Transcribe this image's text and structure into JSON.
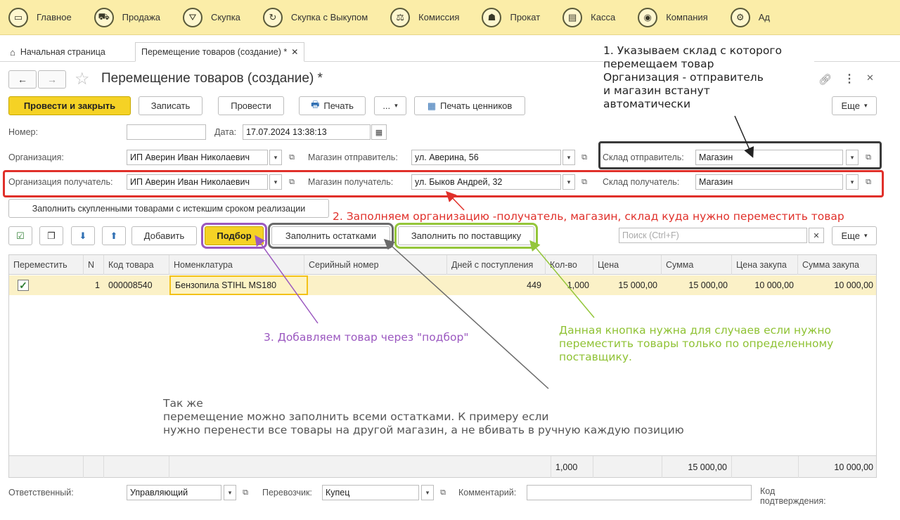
{
  "sections": [
    {
      "label": "Главное",
      "icon": "monitor-icon",
      "glyph": "▭"
    },
    {
      "label": "Продажа",
      "icon": "cart-icon",
      "glyph": "⛟"
    },
    {
      "label": "Скупка",
      "icon": "basket-icon",
      "glyph": "⛛"
    },
    {
      "label": "Скупка с Выкупом",
      "icon": "cycle-icon",
      "glyph": "↻"
    },
    {
      "label": "Комиссия",
      "icon": "scales-icon",
      "glyph": "⚖"
    },
    {
      "label": "Прокат",
      "icon": "rent-icon",
      "glyph": "☗"
    },
    {
      "label": "Касса",
      "icon": "cashbox-icon",
      "glyph": "▤"
    },
    {
      "label": "Компания",
      "icon": "company-icon",
      "glyph": "◉"
    },
    {
      "label": "Ад",
      "icon": "admin-icon",
      "glyph": "⚙"
    }
  ],
  "tabs": {
    "home": "Начальная страница",
    "doc": "Перемещение товаров (создание) *"
  },
  "header": {
    "title": "Перемещение товаров (создание) *"
  },
  "toolbar": {
    "post_close": "Провести и закрыть",
    "write": "Записать",
    "post": "Провести",
    "print": "Печать",
    "more_dots": "...",
    "print_prices": "Печать ценников",
    "more": "Еще"
  },
  "form": {
    "number_label": "Номер:",
    "number_value": "",
    "date_label": "Дата:",
    "date_value": "17.07.2024 13:38:13",
    "org_label": "Организация:",
    "org_value": "ИП Аверин Иван Николаевич",
    "shop_from_label": "Магазин отправитель:",
    "shop_from_value": "ул. Аверина, 56",
    "wh_from_label": "Склад отправитель:",
    "wh_from_value": "Магазин",
    "org_to_label": "Организация получатель:",
    "org_to_value": "ИП Аверин Иван Николаевич",
    "shop_to_label": "Магазин получатель:",
    "shop_to_value": "ул. Быков Андрей, 32",
    "wh_to_label": "Склад получатель:",
    "wh_to_value": "Магазин"
  },
  "fill_expired": "Заполнить скупленными товарами с истекшим сроком реализации",
  "tabletools": {
    "add": "Добавить",
    "pick": "Подбор",
    "fill_rest": "Заполнить остатками",
    "fill_supplier": "Заполнить по поставщику",
    "search_placeholder": "Поиск (Ctrl+F)",
    "more": "Еще"
  },
  "table": {
    "columns": [
      "Переместить",
      "N",
      "Код товара",
      "Номенклатура",
      "Серийный номер",
      "Дней с поступления",
      "Кол-во",
      "Цена",
      "Сумма",
      "Цена закупа",
      "Сумма закупа"
    ],
    "rows": [
      {
        "move": true,
        "n": "1",
        "code": "000008540",
        "name": "Бензопила STIHL MS180",
        "serial": "",
        "days": "449",
        "qty": "1,000",
        "price": "15 000,00",
        "sum": "15 000,00",
        "buy_price": "10 000,00",
        "buy_sum": "10 000,00"
      }
    ],
    "totals": {
      "qty": "1,000",
      "sum": "15 000,00",
      "buy_sum": "10 000,00"
    }
  },
  "bottom": {
    "responsible_label": "Ответственный:",
    "responsible_value": "Управляющий",
    "carrier_label": "Перевозчик:",
    "carrier_value": "Купец",
    "comment_label": "Комментарий:",
    "comment_value": "",
    "code_label_1": "Код",
    "code_label_2": "подтверждения:"
  },
  "notes": {
    "n1_l1": "1. Указываем склад с которого",
    "n1_l2": "перемещаем товар",
    "n1_l3": "Организация - отправитель",
    "n1_l4": "и магазин встанут",
    "n1_l5": "автоматически",
    "n2": "2. Заполняем организацию -получатель, магазин, склад куда нужно переместить товар",
    "n3": "3. Добавляем товар через \"подбор\"",
    "n4_l1": "Данная кнопка нужна для случаев если нужно",
    "n4_l2": "переместить товары только по определенному",
    "n4_l3": "поставщику.",
    "n5_l1": "Так же",
    "n5_l2": "перемещение можно заполнить всеми остатками. К примеру если",
    "n5_l3": "нужно перенести все товары на другой магазин, а не вбивать в ручную каждую позицию"
  },
  "colors": {
    "accent": "#f5d225",
    "red": "#e0302a",
    "purple": "#9b58c0",
    "green": "#94c63a",
    "gray": "#6a6a6a",
    "dark": "#3a3a3a"
  }
}
